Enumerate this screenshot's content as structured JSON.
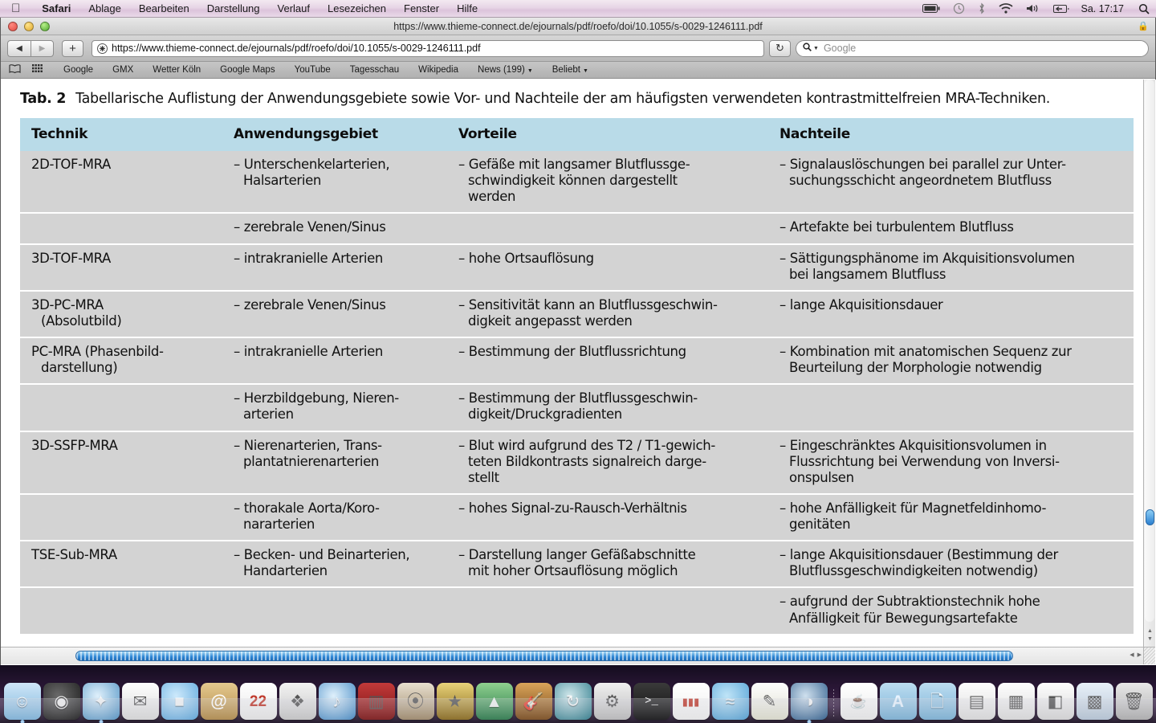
{
  "menubar": {
    "apple_icon": "apple-logo",
    "items": [
      "Safari",
      "Ablage",
      "Bearbeiten",
      "Darstellung",
      "Verlauf",
      "Lesezeichen",
      "Fenster",
      "Hilfe"
    ],
    "status_icons": [
      "battery-icon",
      "time-machine-icon",
      "bluetooth-icon",
      "wifi-icon",
      "volume-icon",
      "eject-icon"
    ],
    "clock": "Sa. 17:17",
    "search_icon": "spotlight-search-icon"
  },
  "window": {
    "title": "https://www.thieme-connect.de/ejournals/pdf/roefo/doi/10.1055/s-0029-1246111.pdf",
    "lock_icon": "lock-icon"
  },
  "toolbar": {
    "back_icon": "back-arrow-icon",
    "forward_icon": "forward-arrow-icon",
    "add_tab_label": "+",
    "url_value": "https://www.thieme-connect.de/ejournals/pdf/roefo/doi/10.1055/s-0029-1246111.pdf",
    "reload_icon": "reload-icon",
    "search_placeholder": "Google",
    "search_icon": "magnifier-icon"
  },
  "bookmarks": {
    "show_all_icon": "book-icon",
    "top_sites_icon": "grid-icon",
    "items": [
      {
        "label": "Google",
        "has_arrow": false
      },
      {
        "label": "GMX",
        "has_arrow": false
      },
      {
        "label": "Wetter Köln",
        "has_arrow": false
      },
      {
        "label": "Google Maps",
        "has_arrow": false
      },
      {
        "label": "YouTube",
        "has_arrow": false
      },
      {
        "label": "Tagesschau",
        "has_arrow": false
      },
      {
        "label": "Wikipedia",
        "has_arrow": false
      },
      {
        "label": "News (199)",
        "has_arrow": true
      },
      {
        "label": "Beliebt",
        "has_arrow": true
      }
    ]
  },
  "document": {
    "caption_number": "Tab. 2",
    "caption_text": "Tabellarische Auflistung der Anwendungsgebiete sowie Vor- und Nachteile der am häufigsten verwendeten kontrastmittelfreien MRA-Techniken.",
    "table": {
      "headers": [
        "Technik",
        "Anwendungsgebiet",
        "Vorteile",
        "Nachteile"
      ],
      "rows": [
        {
          "technik": [
            "2D-TOF-MRA"
          ],
          "anwendungsgebiet": [
            "– Unterschenkelarterien,",
            "Halsarterien"
          ],
          "vorteile": [
            "– Gefäße mit langsamer Blutflussge-",
            "schwindigkeit können dargestellt",
            "werden"
          ],
          "nachteile": [
            "– Signalauslöschungen bei parallel zur Unter-",
            "suchungsschicht angeordnetem Blutfluss"
          ]
        },
        {
          "technik": [],
          "anwendungsgebiet": [
            "– zerebrale Venen/Sinus"
          ],
          "vorteile": [],
          "nachteile": [
            "– Artefakte bei turbulentem Blutfluss"
          ]
        },
        {
          "technik": [
            "3D-TOF-MRA"
          ],
          "anwendungsgebiet": [
            "– intrakranielle Arterien"
          ],
          "vorteile": [
            "– hohe Ortsauflösung"
          ],
          "nachteile": [
            "– Sättigungsphänome im Akquisitionsvolumen",
            "bei langsamem Blutfluss"
          ]
        },
        {
          "technik": [
            "3D-PC-MRA",
            "(Absolutbild)"
          ],
          "anwendungsgebiet": [
            "– zerebrale Venen/Sinus"
          ],
          "vorteile": [
            "– Sensitivität kann an Blutflussgeschwin-",
            "digkeit angepasst werden"
          ],
          "nachteile": [
            "– lange Akquisitionsdauer"
          ]
        },
        {
          "technik": [
            "PC-MRA (Phasenbild-",
            "darstellung)"
          ],
          "anwendungsgebiet": [
            "– intrakranielle Arterien"
          ],
          "vorteile": [
            "– Bestimmung der Blutflussrichtung"
          ],
          "nachteile": [
            "– Kombination mit anatomischen Sequenz zur",
            "Beurteilung der Morphologie notwendig"
          ]
        },
        {
          "technik": [],
          "anwendungsgebiet": [
            "– Herzbildgebung, Nieren-",
            "arterien"
          ],
          "vorteile": [
            "– Bestimmung der Blutflussgeschwin-",
            "digkeit/Druckgradienten"
          ],
          "nachteile": []
        },
        {
          "technik": [
            "3D-SSFP-MRA"
          ],
          "anwendungsgebiet": [
            "– Nierenarterien, Trans-",
            "plantatnierenarterien"
          ],
          "vorteile": [
            "– Blut wird aufgrund des T2 / T1-gewich-",
            "teten Bildkontrasts signalreich darge-",
            "stellt"
          ],
          "nachteile": [
            "– Eingeschränktes Akquisitionsvolumen in",
            "Flussrichtung bei Verwendung von Inversi-",
            "onspulsen"
          ]
        },
        {
          "technik": [],
          "anwendungsgebiet": [
            "– thorakale Aorta/Koro-",
            "nararterien"
          ],
          "vorteile": [
            "– hohes Signal-zu-Rausch-Verhältnis"
          ],
          "nachteile": [
            "– hohe Anfälligkeit für Magnetfeldinhomo-",
            "genitäten"
          ]
        },
        {
          "technik": [
            "TSE-Sub-MRA"
          ],
          "anwendungsgebiet": [
            "– Becken- und Beinarterien,",
            "Handarterien"
          ],
          "vorteile": [
            "– Darstellung langer Gefäßabschnitte",
            "mit hoher Ortsauflösung möglich"
          ],
          "nachteile": [
            "– lange Akquisitionsdauer (Bestimmung der",
            "Blutflussgeschwindigkeiten notwendig)"
          ]
        },
        {
          "technik": [],
          "anwendungsgebiet": [],
          "vorteile": [],
          "nachteile": [
            "– aufgrund der Subtraktionstechnik hohe",
            "Anfälligkeit für Bewegungsartefakte"
          ]
        }
      ]
    }
  },
  "scrollbars": {
    "vertical_up_icon": "chevron-up-icon",
    "vertical_down_icon": "chevron-down-icon",
    "horizontal_left_icon": "chevron-left-icon",
    "horizontal_right_icon": "chevron-right-icon"
  },
  "dock": {
    "items": [
      {
        "name": "finder",
        "glyph": "☺",
        "bg": "linear-gradient(to bottom,#cfe6f7,#7fb6dd)",
        "running": true
      },
      {
        "name": "dashboard",
        "glyph": "◉",
        "bg": "radial-gradient(circle at 40% 35%,#6a6a6a,#1a1a1a)",
        "running": false
      },
      {
        "name": "safari",
        "glyph": "✦",
        "bg": "radial-gradient(circle at 40% 35%,#dff0fb,#4f92c4)",
        "running": true
      },
      {
        "name": "mail",
        "glyph": "✉",
        "bg": "linear-gradient(to bottom,#fdfdfd,#dcdcdc)",
        "running": false
      },
      {
        "name": "facetime",
        "glyph": "■",
        "bg": "radial-gradient(circle at 40% 35%,#cde9fb,#5aa6dd)",
        "running": false
      },
      {
        "name": "address-book",
        "glyph": "@",
        "bg": "linear-gradient(to bottom,#e4c98f,#b48c4a)",
        "running": false
      },
      {
        "name": "ical",
        "glyph": "22",
        "bg": "linear-gradient(to bottom,#ffffff,#e8e8e8)",
        "running": false
      },
      {
        "name": "iphoto",
        "glyph": "❖",
        "bg": "linear-gradient(to bottom,#f2f2f2,#c9c9c9)",
        "running": false
      },
      {
        "name": "itunes",
        "glyph": "♪",
        "bg": "radial-gradient(circle at 40% 35%,#dff0fb,#3f87c4)",
        "running": false
      },
      {
        "name": "photo-booth",
        "glyph": "▥",
        "bg": "linear-gradient(to bottom,#c23a3a,#7d1414)",
        "running": false
      },
      {
        "name": "image-capture",
        "glyph": "⦿",
        "bg": "linear-gradient(to bottom,#e8e0d0,#a08a6a)",
        "running": false
      },
      {
        "name": "imovie",
        "glyph": "★",
        "bg": "linear-gradient(to bottom,#e8d27a,#8a6a1a)",
        "running": false
      },
      {
        "name": "aperture",
        "glyph": "▲",
        "bg": "linear-gradient(to bottom,#8fd08f,#2a7a4a)",
        "running": false
      },
      {
        "name": "garageband",
        "glyph": "🎸",
        "bg": "linear-gradient(to bottom,#d9a45a,#7a4a1a)",
        "running": false
      },
      {
        "name": "time-machine",
        "glyph": "↻",
        "bg": "radial-gradient(circle at 40% 35%,#cfe6ea,#2a7a8a)",
        "running": false
      },
      {
        "name": "system-preferences",
        "glyph": "⚙",
        "bg": "linear-gradient(to bottom,#efefef,#bdbdbd)",
        "running": false
      },
      {
        "name": "terminal",
        "glyph": ">_",
        "bg": "linear-gradient(to bottom,#3a3a3a,#111)",
        "running": false
      },
      {
        "name": "cisco-anyconnect",
        "glyph": "▮▮▮",
        "bg": "linear-gradient(to bottom,#ffffff,#f0f0f0)",
        "running": false
      },
      {
        "name": "openoffice",
        "glyph": "≈",
        "bg": "radial-gradient(circle at 40% 35%,#bfe4f7,#4f9fd4)",
        "running": false
      },
      {
        "name": "textedit",
        "glyph": "✎",
        "bg": "linear-gradient(to bottom,#fdfdfd,#e0e0d0)",
        "running": false
      },
      {
        "name": "quicktime",
        "glyph": "◑",
        "bg": "radial-gradient(circle at 40% 35%,#cfe0ee,#2a5a8a)",
        "running": true
      },
      {
        "name": "separator",
        "glyph": "",
        "bg": "none",
        "running": false
      },
      {
        "name": "jar-file",
        "glyph": "☕",
        "bg": "linear-gradient(to bottom,#ffffff,#ececec)",
        "running": false
      },
      {
        "name": "applications-folder",
        "glyph": "A",
        "bg": "linear-gradient(to bottom,#bcdcf0,#7db4d8)",
        "running": false
      },
      {
        "name": "documents-folder",
        "glyph": "🗋",
        "bg": "linear-gradient(to bottom,#bcdcf0,#7db4d8)",
        "running": false
      },
      {
        "name": "downloads-stack",
        "glyph": "▤",
        "bg": "linear-gradient(to bottom,#fdfdfd,#dedede)",
        "running": false
      },
      {
        "name": "document-stack",
        "glyph": "▦",
        "bg": "linear-gradient(to bottom,#fdfdfd,#dedede)",
        "running": false
      },
      {
        "name": "portrait-document",
        "glyph": "◧",
        "bg": "linear-gradient(to bottom,#fdfdfd,#d8d8d8)",
        "running": false
      },
      {
        "name": "window-stack",
        "glyph": "▩",
        "bg": "linear-gradient(to bottom,#e8f0f8,#b8c8d8)",
        "running": false
      },
      {
        "name": "trash",
        "glyph": "🗑",
        "bg": "linear-gradient(to bottom,#e8e8e8,#b0b0b0)",
        "running": false
      }
    ]
  }
}
